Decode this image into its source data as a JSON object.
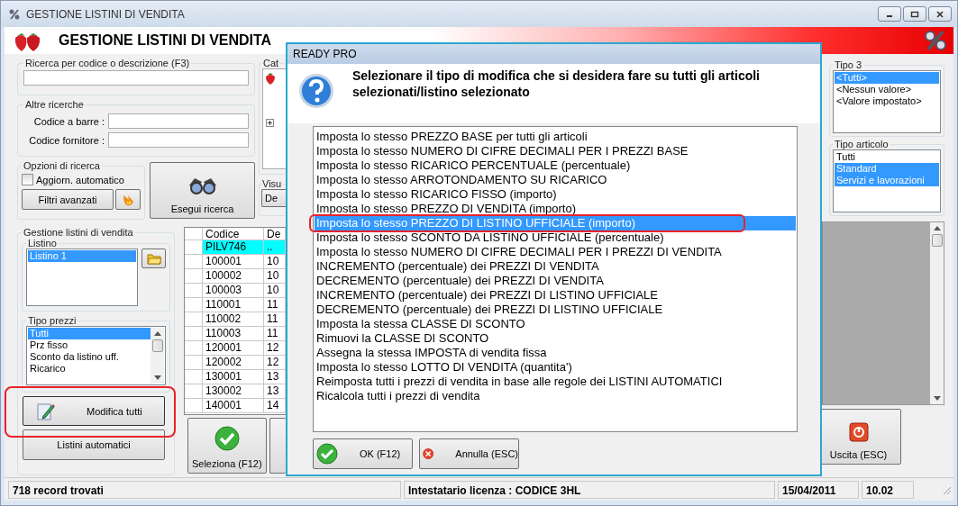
{
  "window": {
    "title": "GESTIONE LISTINI DI VENDITA",
    "header": "GESTIONE LISTINI DI VENDITA"
  },
  "search": {
    "label": "Ricerca per codice o descrizione (F3)"
  },
  "other_searches": {
    "label": "Altre ricerche",
    "fields": [
      {
        "label": "Codice a barre :"
      },
      {
        "label": "Codice fornitore :"
      }
    ]
  },
  "search_options": {
    "label": "Opzioni di ricerca",
    "auto_update": {
      "label": "Aggiorn. automatico",
      "checked": false
    },
    "advanced_filters": "Filtri avanzati"
  },
  "run_search": "Esegui ricerca",
  "category": {
    "label": "Cat"
  },
  "view": {
    "label": "Visu",
    "button": "De"
  },
  "price_lists": {
    "label": "Gestione listini di vendita",
    "listino": {
      "label": "Listino",
      "items": [
        {
          "label": "Listino 1",
          "selected": true
        }
      ]
    },
    "price_types": {
      "label": "Tipo prezzi",
      "items": [
        {
          "label": "Tutti",
          "selected": true
        },
        {
          "label": "Prz fisso",
          "selected": false
        },
        {
          "label": "Sconto da listino uff.",
          "selected": false
        },
        {
          "label": "Ricarico",
          "selected": false
        }
      ]
    },
    "edit_all": {
      "label": "Modifica tutti",
      "circled": true
    },
    "auto_lists": "Listini automatici"
  },
  "grid": {
    "columns": [
      "Codice",
      "De"
    ],
    "rows": [
      {
        "cells": [
          "PILV746",
          ".."
        ],
        "selected": true
      },
      {
        "cells": [
          "100001",
          "10"
        ],
        "selected": false
      },
      {
        "cells": [
          "100002",
          "10"
        ],
        "selected": false
      },
      {
        "cells": [
          "100003",
          "10"
        ],
        "selected": false
      },
      {
        "cells": [
          "110001",
          "11"
        ],
        "selected": false
      },
      {
        "cells": [
          "110002",
          "11"
        ],
        "selected": false
      },
      {
        "cells": [
          "110003",
          "11"
        ],
        "selected": false
      },
      {
        "cells": [
          "120001",
          "12"
        ],
        "selected": false
      },
      {
        "cells": [
          "120002",
          "12"
        ],
        "selected": false
      },
      {
        "cells": [
          "130001",
          "13"
        ],
        "selected": false
      },
      {
        "cells": [
          "130002",
          "13"
        ],
        "selected": false
      },
      {
        "cells": [
          "140001",
          "14"
        ],
        "selected": false
      }
    ]
  },
  "select_button": "Seleziona (F12)",
  "exit_button": "Uscita (ESC)",
  "tipo3": {
    "label": "Tipo 3",
    "items": [
      {
        "label": "<Tutti>",
        "selected": true
      },
      {
        "label": "<Nessun valore>",
        "selected": false
      },
      {
        "label": "<Valore impostato>",
        "selected": false
      }
    ]
  },
  "tipo_articolo": {
    "label": "Tipo articolo",
    "items": [
      {
        "label": "Tutti",
        "selected": false
      },
      {
        "label": "Standard",
        "selected": true
      },
      {
        "label": "Servizi e lavorazioni",
        "selected": true
      }
    ]
  },
  "status_bar": {
    "records": "718 record trovati",
    "license": "Intestatario licenza : CODICE 3HL",
    "date": "15/04/2011",
    "time": "10.02"
  },
  "dialog": {
    "title": "READY PRO",
    "message": "Selezionare il tipo di modifica che si desidera fare su tutti gli articoli selezionati/listino selezionato",
    "options": [
      {
        "label": "Imposta lo stesso PREZZO BASE per tutti gli articoli",
        "selected": false,
        "circled": false
      },
      {
        "label": "Imposta lo stesso NUMERO DI CIFRE DECIMALI PER I PREZZI BASE",
        "selected": false,
        "circled": false
      },
      {
        "label": "Imposta lo stesso RICARICO PERCENTUALE (percentuale)",
        "selected": false,
        "circled": false
      },
      {
        "label": "Imposta lo stesso ARROTONDAMENTO SU RICARICO",
        "selected": false,
        "circled": false
      },
      {
        "label": "Imposta lo stesso RICARICO FISSO (importo)",
        "selected": false,
        "circled": false
      },
      {
        "label": "Imposta lo stesso PREZZO DI VENDITA (importo)",
        "selected": false,
        "circled": false
      },
      {
        "label": "Imposta lo stesso PREZZO DI LISTINO UFFICIALE (importo)",
        "selected": true,
        "circled": true
      },
      {
        "label": "Imposta lo stesso SCONTO DA LISTINO UFFICIALE (percentuale)",
        "selected": false,
        "circled": false
      },
      {
        "label": "Imposta lo stesso NUMERO DI CIFRE DECIMALI PER I PREZZI DI VENDITA",
        "selected": false,
        "circled": false
      },
      {
        "label": "INCREMENTO (percentuale) dei PREZZI DI VENDITA",
        "selected": false,
        "circled": false
      },
      {
        "label": "DECREMENTO (percentuale) dei PREZZI DI VENDITA",
        "selected": false,
        "circled": false
      },
      {
        "label": "INCREMENTO (percentuale) dei PREZZI DI LISTINO UFFICIALE",
        "selected": false,
        "circled": false
      },
      {
        "label": "DECREMENTO (percentuale) dei PREZZI DI LISTINO UFFICIALE",
        "selected": false,
        "circled": false
      },
      {
        "label": "Imposta la stessa CLASSE DI SCONTO",
        "selected": false,
        "circled": false
      },
      {
        "label": "Rimuovi la CLASSE DI SCONTO",
        "selected": false,
        "circled": false
      },
      {
        "label": "Assegna la stessa IMPOSTA di vendita fissa",
        "selected": false,
        "circled": false
      },
      {
        "label": "Imposta lo stesso LOTTO DI VENDITA (quantita')",
        "selected": false,
        "circled": false
      },
      {
        "label": "Reimposta tutti i prezzi di vendita in base alle regole dei LISTINI AUTOMATICI",
        "selected": false,
        "circled": false
      },
      {
        "label": "Ricalcola tutti i prezzi di vendita",
        "selected": false,
        "circled": false
      }
    ],
    "buttons": [
      {
        "label": "OK (F12)",
        "kind": "ok"
      },
      {
        "label": "Annulla (ESC)",
        "kind": "cancel"
      }
    ]
  }
}
